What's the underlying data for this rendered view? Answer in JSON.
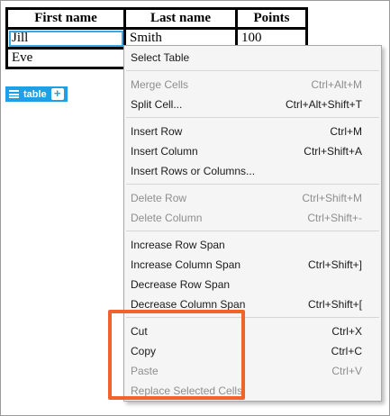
{
  "table": {
    "headers": [
      "First name",
      "Last name",
      "Points"
    ],
    "rows": [
      [
        "Jill",
        "Smith",
        "100"
      ],
      [
        "Eve",
        "",
        ""
      ]
    ]
  },
  "table_tag": {
    "label": "table",
    "icon": "list-icon",
    "plus": "+"
  },
  "context_menu": {
    "groups": [
      [
        {
          "label": "Select Table",
          "shortcut": "",
          "enabled": true
        }
      ],
      [
        {
          "label": "Merge Cells",
          "shortcut": "Ctrl+Alt+M",
          "enabled": false
        },
        {
          "label": "Split Cell...",
          "shortcut": "Ctrl+Alt+Shift+T",
          "enabled": true
        }
      ],
      [
        {
          "label": "Insert Row",
          "shortcut": "Ctrl+M",
          "enabled": true
        },
        {
          "label": "Insert Column",
          "shortcut": "Ctrl+Shift+A",
          "enabled": true
        },
        {
          "label": "Insert Rows or Columns...",
          "shortcut": "",
          "enabled": true
        }
      ],
      [
        {
          "label": "Delete Row",
          "shortcut": "Ctrl+Shift+M",
          "enabled": false
        },
        {
          "label": "Delete Column",
          "shortcut": "Ctrl+Shift+-",
          "enabled": false
        }
      ],
      [
        {
          "label": "Increase Row Span",
          "shortcut": "",
          "enabled": true
        },
        {
          "label": "Increase Column Span",
          "shortcut": "Ctrl+Shift+]",
          "enabled": true
        },
        {
          "label": "Decrease Row Span",
          "shortcut": "",
          "enabled": true
        },
        {
          "label": "Decrease Column Span",
          "shortcut": "Ctrl+Shift+[",
          "enabled": true
        }
      ],
      [
        {
          "label": "Cut",
          "shortcut": "Ctrl+X",
          "enabled": true
        },
        {
          "label": "Copy",
          "shortcut": "Ctrl+C",
          "enabled": true
        },
        {
          "label": "Paste",
          "shortcut": "Ctrl+V",
          "enabled": false
        },
        {
          "label": "Replace Selected Cells",
          "shortcut": "",
          "enabled": false
        }
      ]
    ]
  },
  "colors": {
    "highlight": "#f0642a",
    "table_tag": "#1e9fe6",
    "selection": "#3aa7e2"
  }
}
